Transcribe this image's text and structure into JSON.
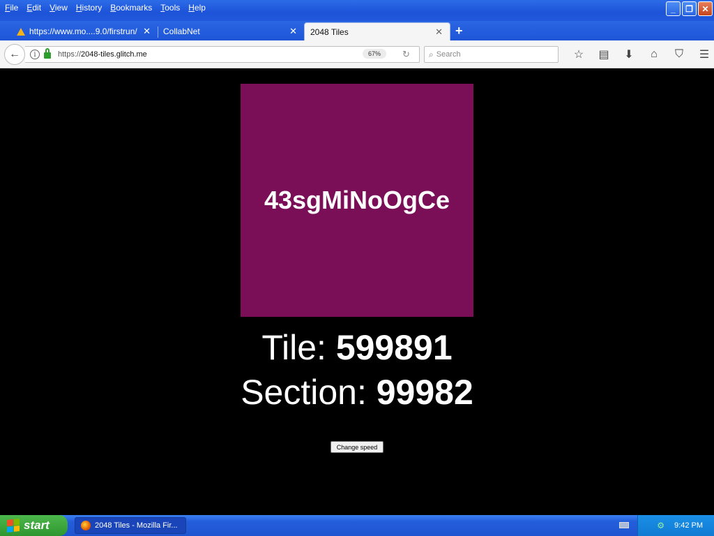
{
  "menu": {
    "items": [
      "File",
      "Edit",
      "View",
      "History",
      "Bookmarks",
      "Tools",
      "Help"
    ]
  },
  "window_controls": {
    "minimize": "_",
    "restore": "❐",
    "close": "✕"
  },
  "tabs": [
    {
      "label": "https://www.mo....9.0/firstrun/",
      "warning": true
    },
    {
      "label": "CollabNet"
    },
    {
      "label": "2048 Tiles",
      "active": true
    }
  ],
  "tab_close": "✕",
  "new_tab": "+",
  "navbar": {
    "back": "←",
    "url_prefix": "https://",
    "url_host": "2048-tiles.glitch.me",
    "zoom": "67%",
    "reload": "↻",
    "search_placeholder": "Search",
    "icons": [
      "star-icon",
      "reading-list-icon",
      "download-icon",
      "home-icon",
      "pocket-icon",
      "menu-icon"
    ]
  },
  "page": {
    "tile_label": "43sgMiNoOgCe",
    "tile_color": "#7a0f57",
    "tile_prefix": "Tile: ",
    "tile_value": "599891",
    "section_prefix": "Section: ",
    "section_value": "99982",
    "speed_button": "Change speed"
  },
  "taskbar": {
    "start_label": "start",
    "task_item": "2048 Tiles - Mozilla Fir...",
    "clock": "9:42 PM"
  }
}
